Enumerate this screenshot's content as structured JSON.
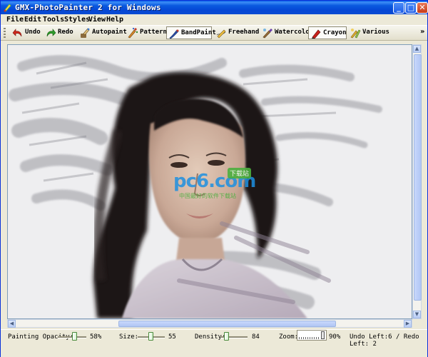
{
  "window": {
    "title": "GMX-PhotoPainter 2 for Windows",
    "controls": {
      "minimize": "_",
      "maximize": "□",
      "close": "✕"
    }
  },
  "menu": [
    "File",
    "Edit",
    "Tools",
    "Styles",
    "View",
    "Help"
  ],
  "toolbar": {
    "items": [
      {
        "label": "Undo",
        "icon": "undo-arrow-icon"
      },
      {
        "label": "Redo",
        "icon": "redo-arrow-icon"
      },
      {
        "label": "Autopaint",
        "icon": "autopaint-brush-icon"
      },
      {
        "label": "Pattern",
        "icon": "pattern-brush-icon"
      },
      {
        "label": "BandPaint",
        "icon": "bandpaint-icon"
      },
      {
        "label": "Freehand",
        "icon": "freehand-pencil-icon"
      },
      {
        "label": "Watercolor",
        "icon": "watercolor-brush-icon"
      },
      {
        "label": "Crayon",
        "icon": "crayon-icon"
      },
      {
        "label": "Various",
        "icon": "various-tools-icon"
      }
    ],
    "active_items": [
      "BandPaint",
      "Crayon"
    ],
    "overflow": "»"
  },
  "canvas": {
    "watermark_main": "pc6.com",
    "watermark_badge": "下载站",
    "watermark_sub": "中国最好的软件下载站"
  },
  "status": {
    "painting_opacity_label": "Painting Opacity:",
    "painting_opacity_value": "58%",
    "painting_opacity_fraction": 0.58,
    "size_label": "Size:",
    "size_value": "55",
    "density_label": "Density:",
    "density_value": "84",
    "zoom_label": "Zoom:",
    "zoom_value": "90%",
    "undo_redo": "Undo Left:6 / Redo Left: 2"
  },
  "colors": {
    "title_bar": "#0a5fe8",
    "chrome": "#ece9d8",
    "canvas_bg": "#eeeef0",
    "watermark_blue": "#1e90e0",
    "watermark_green": "#4caf3f"
  }
}
